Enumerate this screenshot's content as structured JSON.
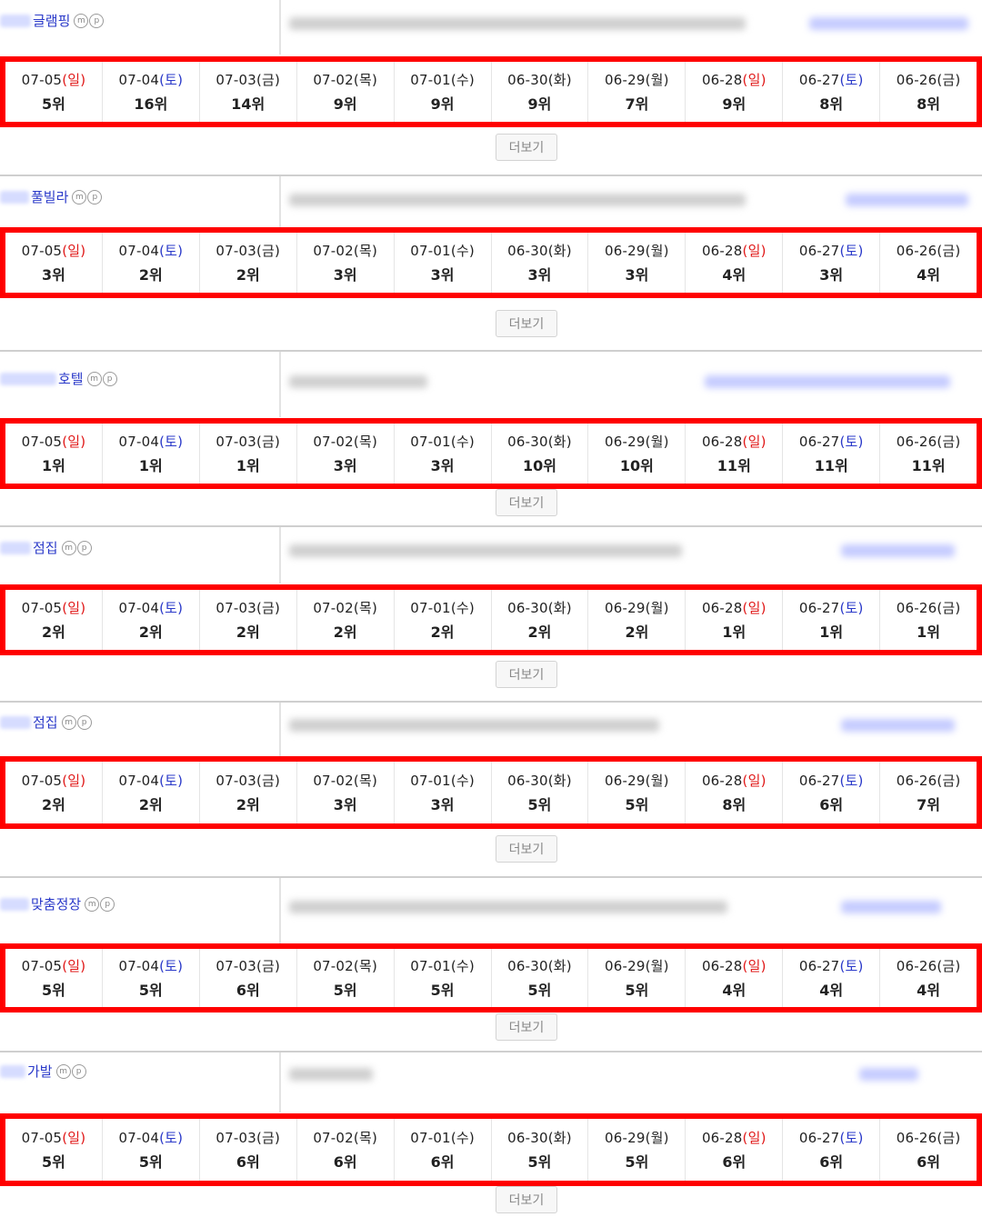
{
  "more_label": "더보기",
  "mp": [
    "m",
    "p"
  ],
  "colors": {
    "sunday": "#e01818",
    "saturday": "#2a39c9",
    "highlight_border": "#ff0000",
    "keyword": "#2a39c9"
  },
  "groups": [
    {
      "keyword": "글램핑",
      "dates": [
        [
          "07-05",
          "(일)",
          "sun"
        ],
        [
          "07-04",
          "(토)",
          "sat"
        ],
        [
          "07-03",
          "(금)",
          ""
        ],
        [
          "07-02",
          "(목)",
          ""
        ],
        [
          "07-01",
          "(수)",
          ""
        ],
        [
          "06-30",
          "(화)",
          ""
        ],
        [
          "06-29",
          "(월)",
          ""
        ],
        [
          "06-28",
          "(일)",
          "sun"
        ],
        [
          "06-27",
          "(토)",
          "sat"
        ],
        [
          "06-26",
          "(금)",
          ""
        ]
      ],
      "ranks": [
        "5위",
        "16위",
        "14위",
        "9위",
        "9위",
        "9위",
        "7위",
        "9위",
        "8위",
        "8위"
      ]
    },
    {
      "keyword": "풀빌라",
      "dates": [
        [
          "07-05",
          "(일)",
          "sun"
        ],
        [
          "07-04",
          "(토)",
          "sat"
        ],
        [
          "07-03",
          "(금)",
          ""
        ],
        [
          "07-02",
          "(목)",
          ""
        ],
        [
          "07-01",
          "(수)",
          ""
        ],
        [
          "06-30",
          "(화)",
          ""
        ],
        [
          "06-29",
          "(월)",
          ""
        ],
        [
          "06-28",
          "(일)",
          "sun"
        ],
        [
          "06-27",
          "(토)",
          "sat"
        ],
        [
          "06-26",
          "(금)",
          ""
        ]
      ],
      "ranks": [
        "3위",
        "2위",
        "2위",
        "3위",
        "3위",
        "3위",
        "3위",
        "4위",
        "3위",
        "4위"
      ]
    },
    {
      "keyword": "호텔",
      "dates": [
        [
          "07-05",
          "(일)",
          "sun"
        ],
        [
          "07-04",
          "(토)",
          "sat"
        ],
        [
          "07-03",
          "(금)",
          ""
        ],
        [
          "07-02",
          "(목)",
          ""
        ],
        [
          "07-01",
          "(수)",
          ""
        ],
        [
          "06-30",
          "(화)",
          ""
        ],
        [
          "06-29",
          "(월)",
          ""
        ],
        [
          "06-28",
          "(일)",
          "sun"
        ],
        [
          "06-27",
          "(토)",
          "sat"
        ],
        [
          "06-26",
          "(금)",
          ""
        ]
      ],
      "ranks": [
        "1위",
        "1위",
        "1위",
        "3위",
        "3위",
        "10위",
        "10위",
        "11위",
        "11위",
        "11위"
      ]
    },
    {
      "keyword": "점집",
      "dates": [
        [
          "07-05",
          "(일)",
          "sun"
        ],
        [
          "07-04",
          "(토)",
          "sat"
        ],
        [
          "07-03",
          "(금)",
          ""
        ],
        [
          "07-02",
          "(목)",
          ""
        ],
        [
          "07-01",
          "(수)",
          ""
        ],
        [
          "06-30",
          "(화)",
          ""
        ],
        [
          "06-29",
          "(월)",
          ""
        ],
        [
          "06-28",
          "(일)",
          "sun"
        ],
        [
          "06-27",
          "(토)",
          "sat"
        ],
        [
          "06-26",
          "(금)",
          ""
        ]
      ],
      "ranks": [
        "2위",
        "2위",
        "2위",
        "2위",
        "2위",
        "2위",
        "2위",
        "1위",
        "1위",
        "1위"
      ]
    },
    {
      "keyword": "점집",
      "dates": [
        [
          "07-05",
          "(일)",
          "sun"
        ],
        [
          "07-04",
          "(토)",
          "sat"
        ],
        [
          "07-03",
          "(금)",
          ""
        ],
        [
          "07-02",
          "(목)",
          ""
        ],
        [
          "07-01",
          "(수)",
          ""
        ],
        [
          "06-30",
          "(화)",
          ""
        ],
        [
          "06-29",
          "(월)",
          ""
        ],
        [
          "06-28",
          "(일)",
          "sun"
        ],
        [
          "06-27",
          "(토)",
          "sat"
        ],
        [
          "06-26",
          "(금)",
          ""
        ]
      ],
      "ranks": [
        "2위",
        "2위",
        "2위",
        "3위",
        "3위",
        "5위",
        "5위",
        "8위",
        "6위",
        "7위"
      ]
    },
    {
      "keyword": "맞춤정장",
      "dates": [
        [
          "07-05",
          "(일)",
          "sun"
        ],
        [
          "07-04",
          "(토)",
          "sat"
        ],
        [
          "07-03",
          "(금)",
          ""
        ],
        [
          "07-02",
          "(목)",
          ""
        ],
        [
          "07-01",
          "(수)",
          ""
        ],
        [
          "06-30",
          "(화)",
          ""
        ],
        [
          "06-29",
          "(월)",
          ""
        ],
        [
          "06-28",
          "(일)",
          "sun"
        ],
        [
          "06-27",
          "(토)",
          "sat"
        ],
        [
          "06-26",
          "(금)",
          ""
        ]
      ],
      "ranks": [
        "5위",
        "5위",
        "6위",
        "5위",
        "5위",
        "5위",
        "5위",
        "4위",
        "4위",
        "4위"
      ]
    },
    {
      "keyword": "가발",
      "dates": [
        [
          "07-05",
          "(일)",
          "sun"
        ],
        [
          "07-04",
          "(토)",
          "sat"
        ],
        [
          "07-03",
          "(금)",
          ""
        ],
        [
          "07-02",
          "(목)",
          ""
        ],
        [
          "07-01",
          "(수)",
          ""
        ],
        [
          "06-30",
          "(화)",
          ""
        ],
        [
          "06-29",
          "(월)",
          ""
        ],
        [
          "06-28",
          "(일)",
          "sun"
        ],
        [
          "06-27",
          "(토)",
          "sat"
        ],
        [
          "06-26",
          "(금)",
          ""
        ]
      ],
      "ranks": [
        "5위",
        "5위",
        "6위",
        "6위",
        "6위",
        "5위",
        "5위",
        "6위",
        "6위",
        "6위"
      ]
    }
  ]
}
